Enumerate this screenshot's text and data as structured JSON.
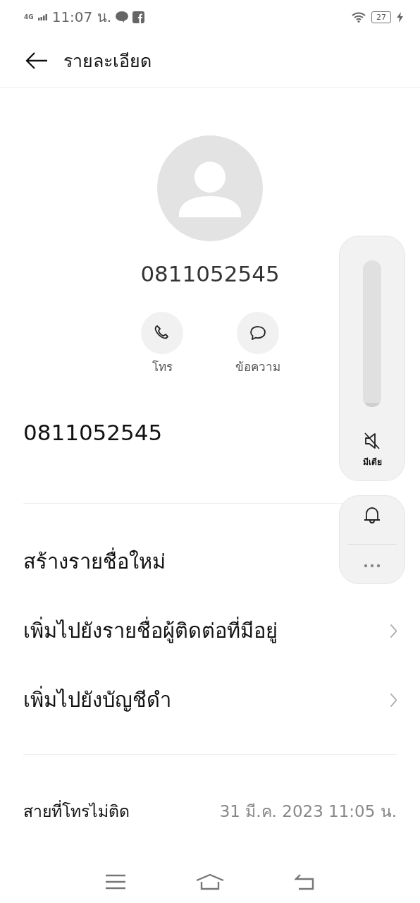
{
  "status_bar": {
    "network": "4G",
    "time": "11:07 น.",
    "battery": "27"
  },
  "header": {
    "title": "รายละเอียด"
  },
  "contact": {
    "name": "0811052545"
  },
  "actions": [
    {
      "kind": "call",
      "label": "โทร"
    },
    {
      "kind": "message",
      "label": "ข้อความ"
    }
  ],
  "phone_number": "0811052545",
  "options": [
    {
      "label": "สร้างรายชื่อใหม่",
      "chevron": false
    },
    {
      "label": "เพิ่มไปยังรายชื่อผู้ติดต่อที่มีอยู่",
      "chevron": true
    },
    {
      "label": "เพิ่มไปยังบัญชีดำ",
      "chevron": true
    }
  ],
  "call_log": [
    {
      "type": "สายที่โทรไม่ติด",
      "time": "31 มี.ค. 2023 11:05 น."
    }
  ],
  "volume_panel": {
    "level": 0,
    "muted": true,
    "label": "มีเดีย"
  }
}
